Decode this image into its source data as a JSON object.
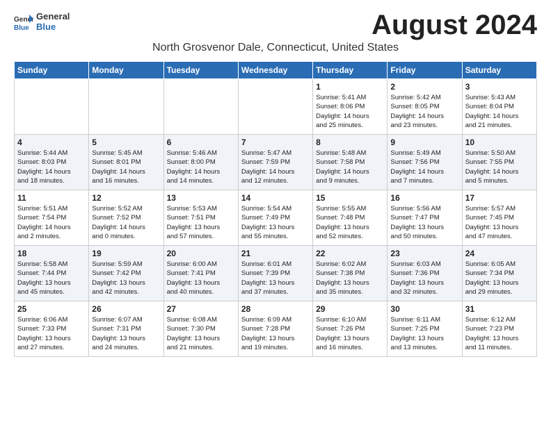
{
  "header": {
    "logo_general": "General",
    "logo_blue": "Blue",
    "month_year": "August 2024",
    "location": "North Grosvenor Dale, Connecticut, United States"
  },
  "days_of_week": [
    "Sunday",
    "Monday",
    "Tuesday",
    "Wednesday",
    "Thursday",
    "Friday",
    "Saturday"
  ],
  "weeks": [
    {
      "days": [
        {
          "num": "",
          "info": ""
        },
        {
          "num": "",
          "info": ""
        },
        {
          "num": "",
          "info": ""
        },
        {
          "num": "",
          "info": ""
        },
        {
          "num": "1",
          "info": "Sunrise: 5:41 AM\nSunset: 8:06 PM\nDaylight: 14 hours\nand 25 minutes."
        },
        {
          "num": "2",
          "info": "Sunrise: 5:42 AM\nSunset: 8:05 PM\nDaylight: 14 hours\nand 23 minutes."
        },
        {
          "num": "3",
          "info": "Sunrise: 5:43 AM\nSunset: 8:04 PM\nDaylight: 14 hours\nand 21 minutes."
        }
      ]
    },
    {
      "days": [
        {
          "num": "4",
          "info": "Sunrise: 5:44 AM\nSunset: 8:03 PM\nDaylight: 14 hours\nand 18 minutes."
        },
        {
          "num": "5",
          "info": "Sunrise: 5:45 AM\nSunset: 8:01 PM\nDaylight: 14 hours\nand 16 minutes."
        },
        {
          "num": "6",
          "info": "Sunrise: 5:46 AM\nSunset: 8:00 PM\nDaylight: 14 hours\nand 14 minutes."
        },
        {
          "num": "7",
          "info": "Sunrise: 5:47 AM\nSunset: 7:59 PM\nDaylight: 14 hours\nand 12 minutes."
        },
        {
          "num": "8",
          "info": "Sunrise: 5:48 AM\nSunset: 7:58 PM\nDaylight: 14 hours\nand 9 minutes."
        },
        {
          "num": "9",
          "info": "Sunrise: 5:49 AM\nSunset: 7:56 PM\nDaylight: 14 hours\nand 7 minutes."
        },
        {
          "num": "10",
          "info": "Sunrise: 5:50 AM\nSunset: 7:55 PM\nDaylight: 14 hours\nand 5 minutes."
        }
      ]
    },
    {
      "days": [
        {
          "num": "11",
          "info": "Sunrise: 5:51 AM\nSunset: 7:54 PM\nDaylight: 14 hours\nand 2 minutes."
        },
        {
          "num": "12",
          "info": "Sunrise: 5:52 AM\nSunset: 7:52 PM\nDaylight: 14 hours\nand 0 minutes."
        },
        {
          "num": "13",
          "info": "Sunrise: 5:53 AM\nSunset: 7:51 PM\nDaylight: 13 hours\nand 57 minutes."
        },
        {
          "num": "14",
          "info": "Sunrise: 5:54 AM\nSunset: 7:49 PM\nDaylight: 13 hours\nand 55 minutes."
        },
        {
          "num": "15",
          "info": "Sunrise: 5:55 AM\nSunset: 7:48 PM\nDaylight: 13 hours\nand 52 minutes."
        },
        {
          "num": "16",
          "info": "Sunrise: 5:56 AM\nSunset: 7:47 PM\nDaylight: 13 hours\nand 50 minutes."
        },
        {
          "num": "17",
          "info": "Sunrise: 5:57 AM\nSunset: 7:45 PM\nDaylight: 13 hours\nand 47 minutes."
        }
      ]
    },
    {
      "days": [
        {
          "num": "18",
          "info": "Sunrise: 5:58 AM\nSunset: 7:44 PM\nDaylight: 13 hours\nand 45 minutes."
        },
        {
          "num": "19",
          "info": "Sunrise: 5:59 AM\nSunset: 7:42 PM\nDaylight: 13 hours\nand 42 minutes."
        },
        {
          "num": "20",
          "info": "Sunrise: 6:00 AM\nSunset: 7:41 PM\nDaylight: 13 hours\nand 40 minutes."
        },
        {
          "num": "21",
          "info": "Sunrise: 6:01 AM\nSunset: 7:39 PM\nDaylight: 13 hours\nand 37 minutes."
        },
        {
          "num": "22",
          "info": "Sunrise: 6:02 AM\nSunset: 7:38 PM\nDaylight: 13 hours\nand 35 minutes."
        },
        {
          "num": "23",
          "info": "Sunrise: 6:03 AM\nSunset: 7:36 PM\nDaylight: 13 hours\nand 32 minutes."
        },
        {
          "num": "24",
          "info": "Sunrise: 6:05 AM\nSunset: 7:34 PM\nDaylight: 13 hours\nand 29 minutes."
        }
      ]
    },
    {
      "days": [
        {
          "num": "25",
          "info": "Sunrise: 6:06 AM\nSunset: 7:33 PM\nDaylight: 13 hours\nand 27 minutes."
        },
        {
          "num": "26",
          "info": "Sunrise: 6:07 AM\nSunset: 7:31 PM\nDaylight: 13 hours\nand 24 minutes."
        },
        {
          "num": "27",
          "info": "Sunrise: 6:08 AM\nSunset: 7:30 PM\nDaylight: 13 hours\nand 21 minutes."
        },
        {
          "num": "28",
          "info": "Sunrise: 6:09 AM\nSunset: 7:28 PM\nDaylight: 13 hours\nand 19 minutes."
        },
        {
          "num": "29",
          "info": "Sunrise: 6:10 AM\nSunset: 7:26 PM\nDaylight: 13 hours\nand 16 minutes."
        },
        {
          "num": "30",
          "info": "Sunrise: 6:11 AM\nSunset: 7:25 PM\nDaylight: 13 hours\nand 13 minutes."
        },
        {
          "num": "31",
          "info": "Sunrise: 6:12 AM\nSunset: 7:23 PM\nDaylight: 13 hours\nand 11 minutes."
        }
      ]
    }
  ]
}
